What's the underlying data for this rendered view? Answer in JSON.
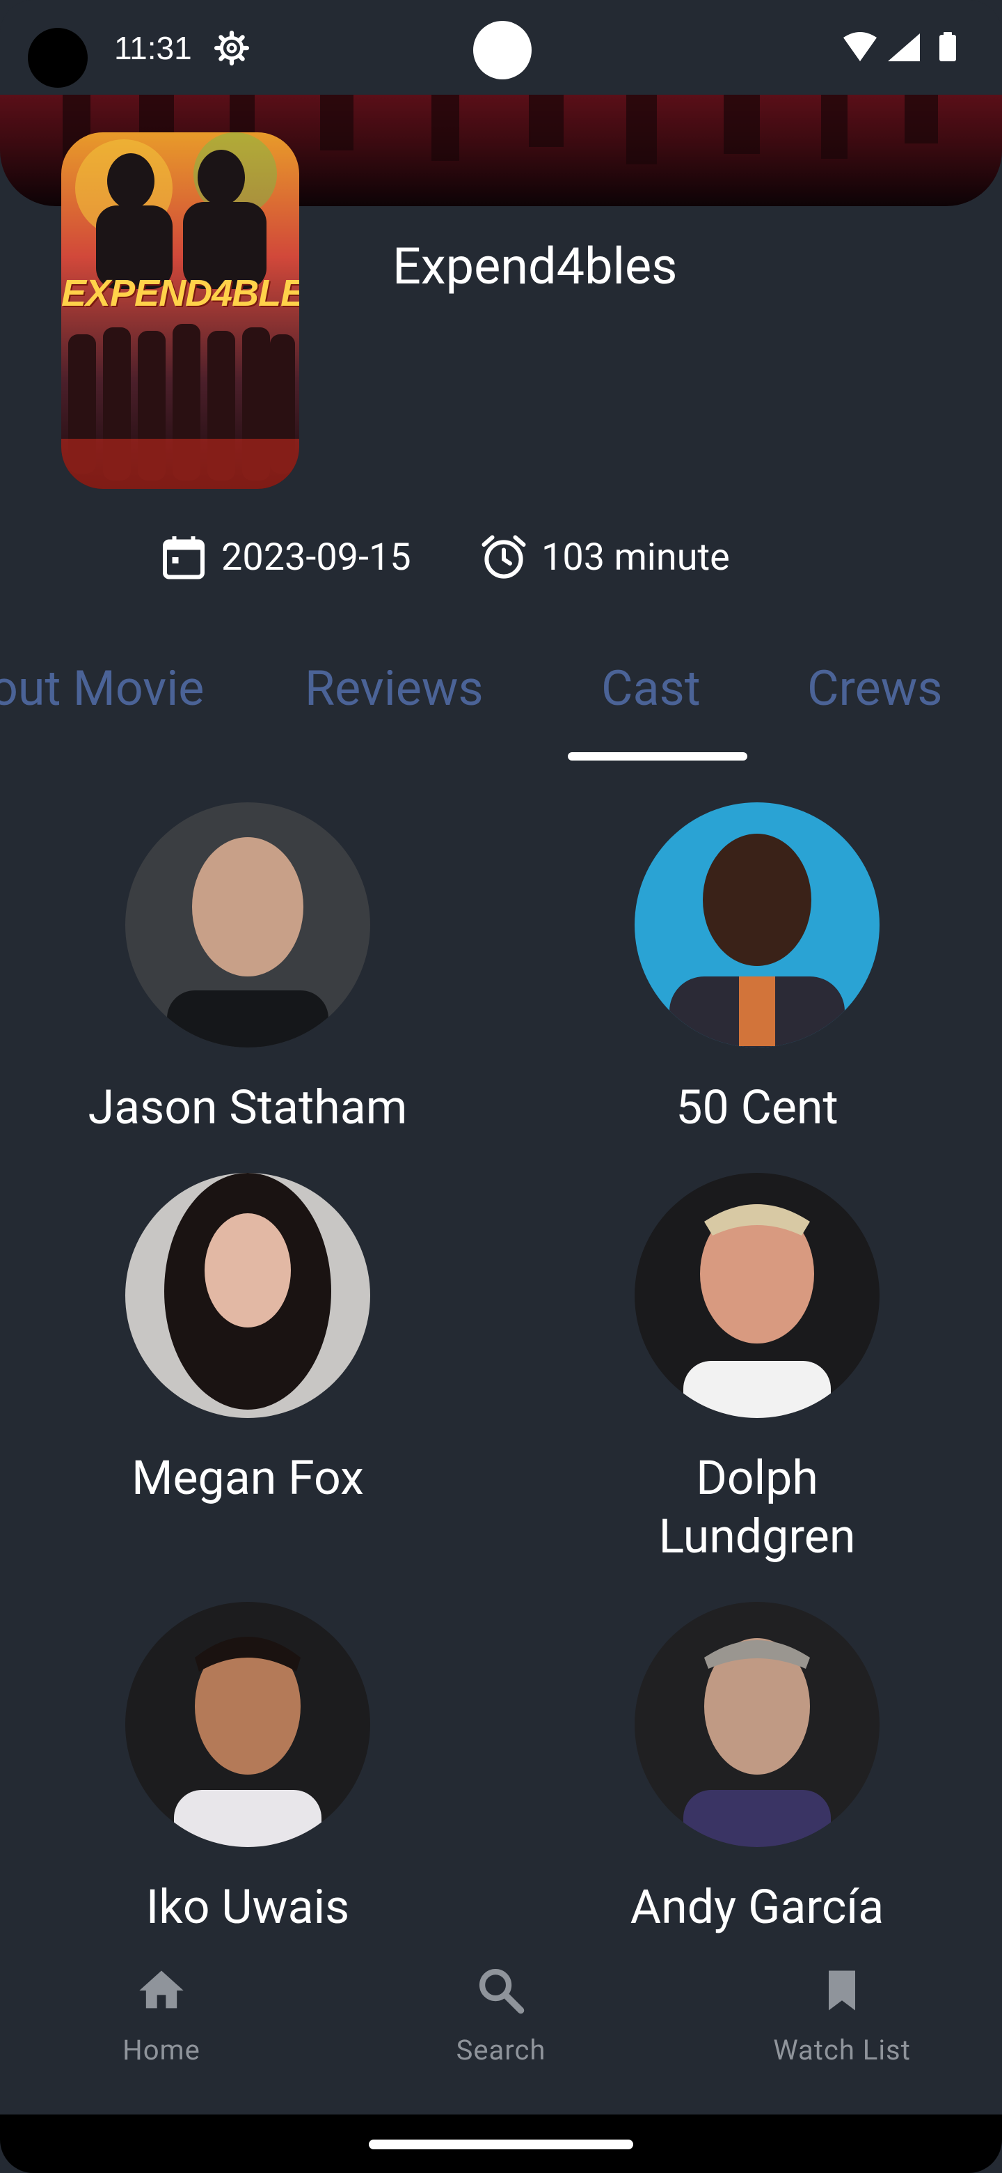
{
  "status_bar": {
    "time": "11:31"
  },
  "movie": {
    "title": "Expend4bles",
    "poster_text": "EXPEND4BLES",
    "release_date": "2023-09-15",
    "runtime": "103 minute"
  },
  "tabs": [
    {
      "label": "About Movie",
      "visible_label": "out Movie"
    },
    {
      "label": "Reviews"
    },
    {
      "label": "Cast",
      "selected": true
    },
    {
      "label": "Crews"
    }
  ],
  "cast": [
    {
      "name": "Jason Statham"
    },
    {
      "name": "50 Cent"
    },
    {
      "name": "Megan Fox"
    },
    {
      "name": "Dolph Lundgren"
    },
    {
      "name": "Iko Uwais"
    },
    {
      "name": "Andy García"
    }
  ],
  "bottom_nav": [
    {
      "label": "Home",
      "icon": "home-icon"
    },
    {
      "label": "Search",
      "icon": "search-icon"
    },
    {
      "label": "Watch List",
      "icon": "bookmark-icon"
    }
  ],
  "colors": {
    "background": "#242a33",
    "tab_inactive": "#4b6397",
    "nav_inactive": "#8f949b"
  }
}
